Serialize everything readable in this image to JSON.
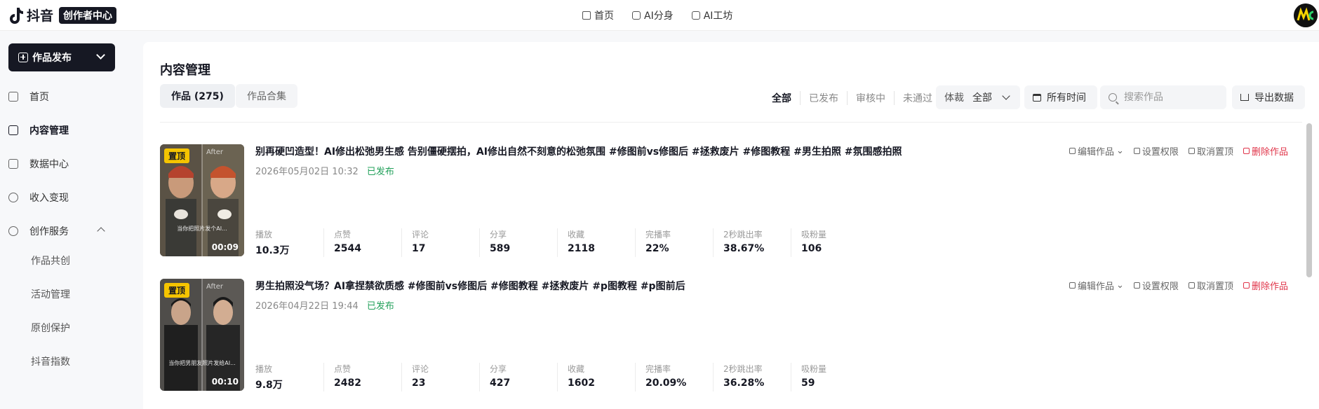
{
  "header": {
    "logo_text": "抖音",
    "logo_badge": "创作者中心",
    "nav": [
      "首页",
      "AI分身",
      "AI工坊"
    ]
  },
  "sidebar": {
    "publish_label": "作品发布",
    "items": [
      {
        "label": "首页",
        "icon": "home-icon"
      },
      {
        "label": "内容管理",
        "icon": "content-icon"
      },
      {
        "label": "数据中心",
        "icon": "chart-icon"
      },
      {
        "label": "收入变现",
        "icon": "income-icon"
      },
      {
        "label": "创作服务",
        "icon": "lightning-icon"
      }
    ],
    "sub_items": [
      "作品共创",
      "活动管理",
      "原创保护",
      "抖音指数"
    ]
  },
  "main": {
    "title": "内容管理",
    "tabs": [
      "作品 (275)",
      "作品合集"
    ],
    "filters": [
      "全部",
      "已发布",
      "审核中",
      "未通过"
    ],
    "genre_label": "体裁",
    "genre_value": "全部",
    "time_label": "所有时间",
    "search_placeholder": "搜索作品",
    "export_label": "导出数据"
  },
  "stat_labels": [
    "播放",
    "点赞",
    "评论",
    "分享",
    "收藏",
    "完播率",
    "2秒跳出率",
    "吸粉量"
  ],
  "actions": [
    "编辑作品",
    "设置权限",
    "取消置顶",
    "删除作品"
  ],
  "works": [
    {
      "pin": "置顶",
      "after_label": "After",
      "duration": "00:09",
      "caption": "当你把照片发个AI...",
      "title": "别再硬凹造型！AI修出松弛男生感 告别僵硬摆拍，AI修出自然不刻意的松弛氛围 #修图前vs修图后 #拯救废片 #修图教程 #男生拍照 #氛围感拍照",
      "date": "2026年05月02日 10:32",
      "status": "已发布",
      "stats": [
        "10.3万",
        "2544",
        "17",
        "589",
        "2118",
        "22%",
        "38.67%",
        "106"
      ]
    },
    {
      "pin": "置顶",
      "after_label": "After",
      "duration": "00:10",
      "caption": "当你把男朋友照片发给AI...",
      "title": "男生拍照没气场？AI拿捏禁欲质感 #修图前vs修图后 #修图教程 #拯救废片 #p图教程 #p图前后",
      "date": "2026年04月22日 19:44",
      "status": "已发布",
      "stats": [
        "9.8万",
        "2482",
        "23",
        "427",
        "1602",
        "20.09%",
        "36.28%",
        "59"
      ]
    }
  ]
}
